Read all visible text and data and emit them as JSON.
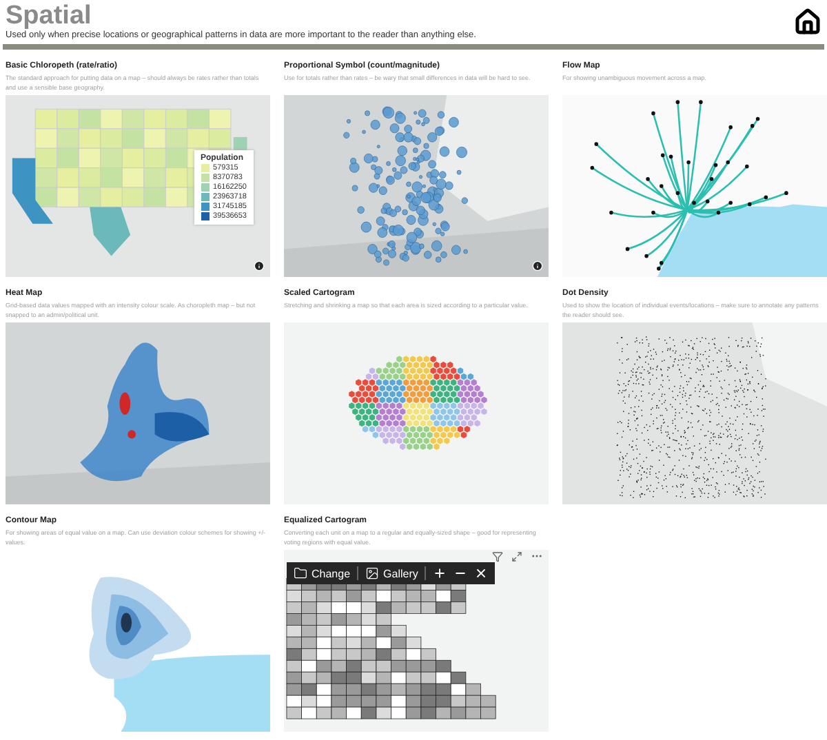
{
  "header": {
    "title": "Spatial",
    "subtitle": "Used only when precise locations or geographical patterns in data are more important to the reader than anything else."
  },
  "cards": [
    {
      "kind": "choropleth",
      "title": "Basic Chloropeth (rate/ratio)",
      "description": "The standard approach for putting data on a map – should always be rates rather than totals and use a sensible base geography.",
      "legend": {
        "title": "Population",
        "items": [
          {
            "label": "579315",
            "color": "#e6efa0"
          },
          {
            "label": "8370783",
            "color": "#c4e3a2"
          },
          {
            "label": "16162250",
            "color": "#9dd3b2"
          },
          {
            "label": "23963718",
            "color": "#6cb9b9"
          },
          {
            "label": "31745185",
            "color": "#3d93c2"
          },
          {
            "label": "39536653",
            "color": "#1b62a9"
          }
        ]
      }
    },
    {
      "kind": "symbol",
      "title": "Proportional Symbol (count/magnitude)",
      "description": "Use for totals rather than rates – be wary that small differences in data will be hard to see."
    },
    {
      "kind": "flow",
      "title": "Flow Map",
      "description": "For showing unambiguous movement across a map."
    },
    {
      "kind": "heat",
      "title": "Heat Map",
      "description": "Grid-based data values mapped with an intensity colour scale. As choropleth map – but not snapped to an admin/political unit."
    },
    {
      "kind": "cartogram",
      "title": "Scaled Cartogram",
      "description": "Stretching and shrinking a map so that each area is sized according to a particular value."
    },
    {
      "kind": "dots",
      "title": "Dot Density",
      "description": "Used to show the location of individual events/locations – make sure to annotate any patterns the reader should see."
    },
    {
      "kind": "contour",
      "title": "Contour Map",
      "description": "For showing areas of equal value on a map. Can use deviation colour schemes for showing +/- values."
    },
    {
      "kind": "equalized",
      "title": "Equalized Cartogram",
      "description": "Converting each unit on a map to a regular and equally-sized shape – good for representing voting regions with equal value.",
      "toolbar": {
        "buttons": [
          {
            "kind": "folder",
            "label": "Change"
          },
          {
            "kind": "gallery",
            "label": "Gallery"
          },
          {
            "kind": "plus"
          },
          {
            "kind": "minus"
          },
          {
            "kind": "close"
          }
        ]
      }
    }
  ]
}
